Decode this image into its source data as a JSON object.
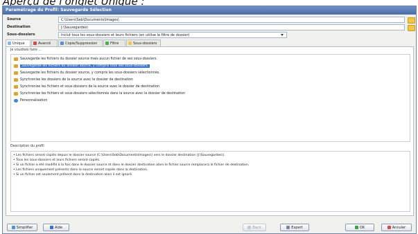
{
  "caption": "Aperçu de l'onglet Unique :",
  "window": {
    "title": "Paramétrage du Profil: Sauvegarde Sélection"
  },
  "fields": {
    "source_label": "Source",
    "source_value": "C:\\Users\\Seb\\Documents\\Images\\",
    "destination_label": "Destination",
    "destination_value": "J:\\Sauvegardes\\",
    "subfolders_label": "Sous-dossiers",
    "subfolders_value": "Inclut tous les sous-dossiers et leurs fichiers (en utilise le filtre de dossier)"
  },
  "tabs": [
    {
      "label": "Unique",
      "icon": "single-icon",
      "color": "#8bb6e6"
    },
    {
      "label": "Avancé",
      "icon": "advanced-icon",
      "color": "#d24b4b"
    },
    {
      "label": "Copie/Suppression",
      "icon": "copy-icon",
      "color": "#5b8fd4"
    },
    {
      "label": "Filtre",
      "icon": "filter-icon",
      "color": "#4caf50"
    },
    {
      "label": "Sous-dossiers",
      "icon": "folder-icon",
      "color": "#f4c542"
    }
  ],
  "prompt": "Je voudrais faire ...",
  "options": [
    {
      "text": "Sauvegarde les fichiers du dossier source mais aucun fichier de ses sous-dossiers.",
      "selected": false
    },
    {
      "text": "Sauvegarde les fichiers du dossier source, y compris tous ses sous-dossiers.",
      "selected": true
    },
    {
      "text": "Sauvegarde les fichiers du dossier source, y compris les sous-dossiers sélectionnés.",
      "selected": false
    },
    {
      "text": "Synchronise les dossiers de la source avec le dossier de destination",
      "selected": false
    },
    {
      "text": "Synchronise les fichiers et sous-dossiers de la source avec le dossier de destination",
      "selected": false
    },
    {
      "text": "Synchronise les fichiers et sous-dossiers sélectionnés dans la source avec le dossier de destination",
      "selected": false
    },
    {
      "text": "Personnalisation",
      "selected": false
    }
  ],
  "description": {
    "heading": "Description du profil",
    "lines": [
      "• Les fichiers seront copiés depuis le dossier source (C:\\Users\\Seb\\Documents\\Images\\) vers le dossier destination (J:\\Sauvegardes\\).",
      "• Tous les sous-dossiers et leurs fichiers seront copiés.",
      "• Si un fichier a été modifié à la fois dans le dossier source et dans le dossier destination alors le fichier source remplacera le fichier de destination.",
      "• Les fichiers uniquement présents dans la source seront copiés dans la destination.",
      "• Si un fichier est seulement présent dans la destination alors il est ignoré."
    ]
  },
  "buttons": {
    "simplify": "Simplifier",
    "help": "Aide",
    "back": "Back",
    "expert": "Expert",
    "ok": "OK",
    "cancel": "Annuler"
  }
}
